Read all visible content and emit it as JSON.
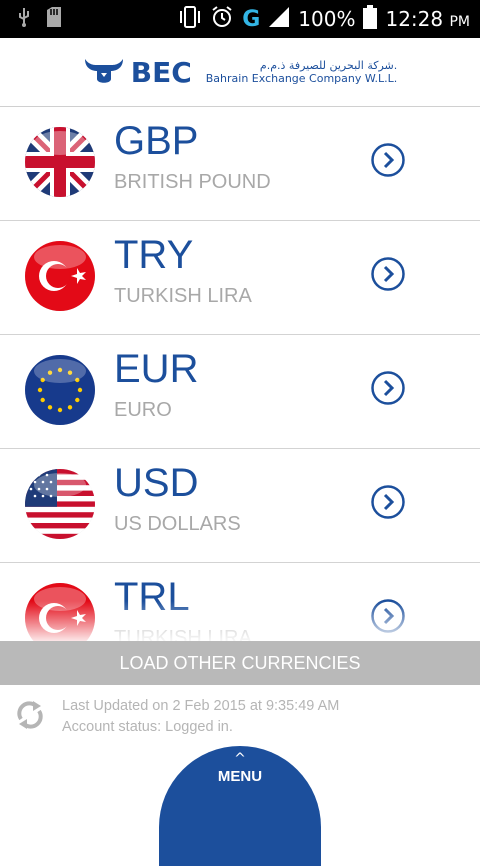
{
  "status_bar": {
    "battery": "100%",
    "network": "G",
    "time": "12:28",
    "ampm": "PM"
  },
  "header": {
    "logo_text": "BEC",
    "arabic_name": "شركة البحرين للصيرفة ذ.م.م.",
    "english_name": "Bahrain Exchange Company W.L.L."
  },
  "currencies": [
    {
      "code": "GBP",
      "name": "BRITISH POUND",
      "flag": "uk"
    },
    {
      "code": "TRY",
      "name": "TURKISH LIRA",
      "flag": "turkey"
    },
    {
      "code": "EUR",
      "name": "EURO",
      "flag": "eu"
    },
    {
      "code": "USD",
      "name": "US DOLLARS",
      "flag": "us"
    },
    {
      "code": "TRL",
      "name": "TURKISH LIRA",
      "flag": "turkey"
    }
  ],
  "load_button": "LOAD OTHER CURRENCIES",
  "footer": {
    "last_updated": "Last Updated on 2 Feb 2015 at 9:35:49 AM",
    "account_status": "Account status: Logged in."
  },
  "menu": {
    "label": "MENU",
    "caret": "^"
  },
  "colors": {
    "brand": "#1c4f9c",
    "muted": "#a8a8a8",
    "button_gray": "#b9b9b9"
  }
}
